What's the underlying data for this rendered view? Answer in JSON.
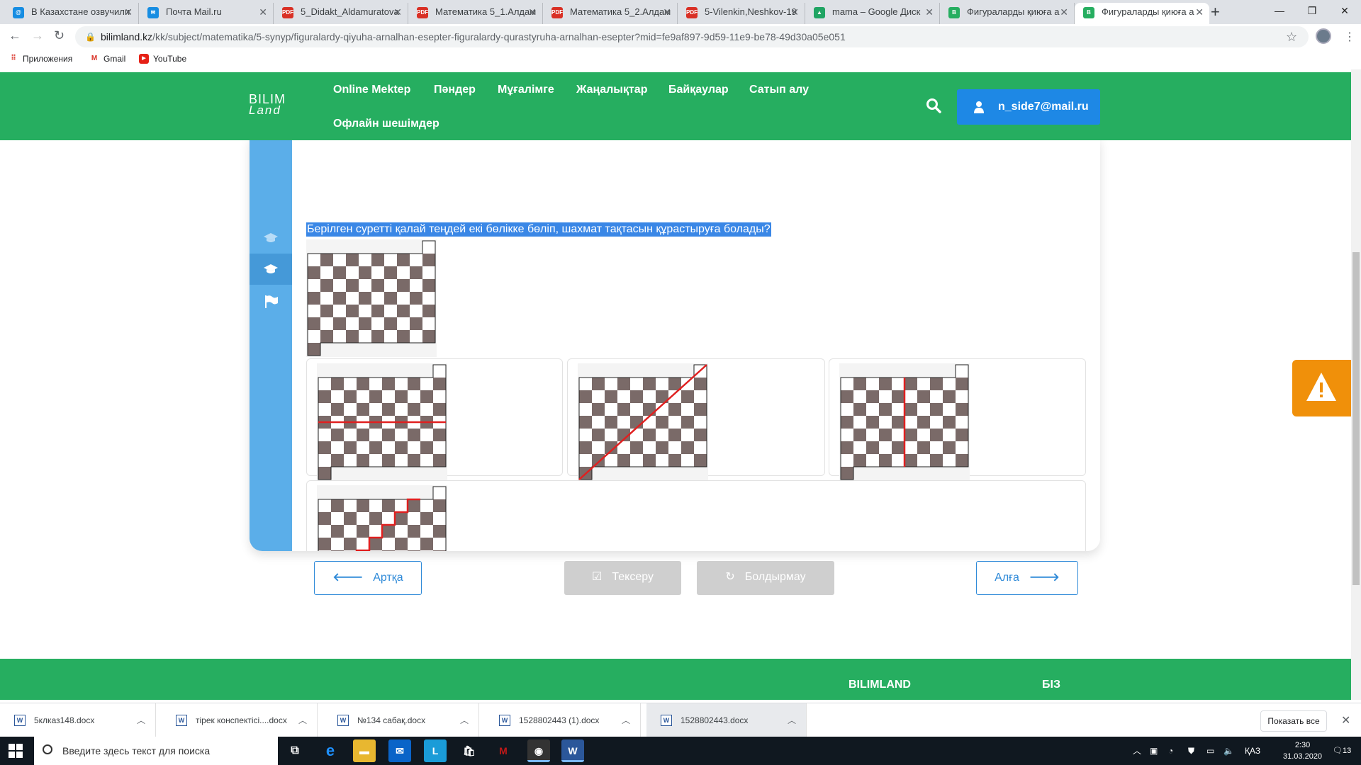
{
  "browser": {
    "tabs": [
      {
        "label": "В Казахстане озвучили",
        "icon": "mail-ru-icon",
        "color": "#168de2"
      },
      {
        "label": "Почта Mail.ru",
        "icon": "mail-icon",
        "color": "#168de2"
      },
      {
        "label": "5_Didakt_Aldamuratova",
        "icon": "pdf-icon",
        "color": "#d93025"
      },
      {
        "label": "Математика 5_1.Алдам",
        "icon": "pdf-icon",
        "color": "#d93025"
      },
      {
        "label": "Математика 5_2.Алдам",
        "icon": "pdf-icon",
        "color": "#d93025"
      },
      {
        "label": "5-Vilenkin,Neshkov-19",
        "icon": "pdf-icon",
        "color": "#d93025"
      },
      {
        "label": "mama – Google Диск",
        "icon": "google-drive-icon",
        "color": "#1fa463"
      },
      {
        "label": "Фигураларды қиюға а",
        "icon": "bilimland-icon",
        "color": "#26ae60"
      },
      {
        "label": "Фигураларды қиюға а",
        "icon": "bilimland-icon",
        "color": "#26ae60",
        "active": true
      }
    ],
    "url_host": "bilimland.kz",
    "url_path": "/kk/subject/matematika/5-synyp/figuralardy-qiyuha-arnalhan-esepter-figuralardy-qurastyruha-arnalhan-esepter?mid=fe9af897-9d59-11e9-be78-49d30a05e051",
    "bookmarks": [
      {
        "label": "Приложения",
        "icon": "apps-grid-icon"
      },
      {
        "label": "Gmail",
        "icon": "gmail-icon"
      },
      {
        "label": "YouTube",
        "icon": "youtube-icon"
      }
    ]
  },
  "site": {
    "logo_line1": "BILIM",
    "logo_line2": "Land",
    "nav": [
      "Online Mektep",
      "Пәндер",
      "Мұғалімге",
      "Жаңалықтар",
      "Байқаулар",
      "Сатып алу",
      "Офлайн шешімдер"
    ],
    "user_email": "n_side7@mail.ru",
    "brand_color": "#26ae60",
    "accent_color": "#1e88e5"
  },
  "lesson": {
    "question": "Берілген суретті қалай теңдей екі бөлікке бөліп, шахмат тақтасын құрастыруға болады?",
    "options": [
      {
        "id": "a",
        "cut": "horizontal"
      },
      {
        "id": "b",
        "cut": "diagonal"
      },
      {
        "id": "c",
        "cut": "vertical"
      },
      {
        "id": "d",
        "cut": "staircase"
      }
    ],
    "buttons": {
      "back": "Артқа",
      "check": "Тексеру",
      "reset": "Болдырмау",
      "next": "Алға"
    },
    "cut_color": "#e02020",
    "dark_cell_color": "#7a6a68"
  },
  "footer": {
    "col1": "BILIMLAND",
    "col2": "БІЗ"
  },
  "downloads": {
    "items": [
      "5клказ148.docx",
      "тірек конспектісі....docx",
      "№134 сабақ.docx",
      "1528802443 (1).docx",
      "1528802443.docx"
    ],
    "show_all": "Показать все"
  },
  "taskbar": {
    "search_placeholder": "Введите здесь текст для поиска",
    "lang": "ҚАЗ",
    "time": "2:30",
    "date": "31.03.2020",
    "notifications": "13"
  }
}
